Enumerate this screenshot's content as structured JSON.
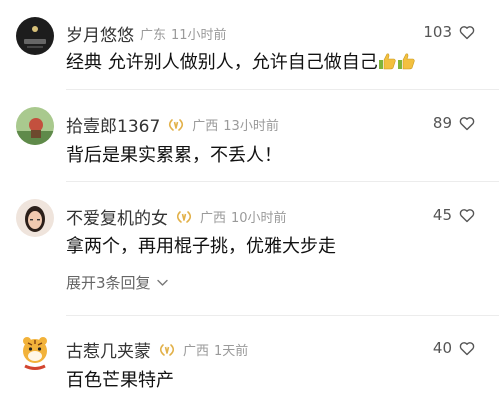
{
  "comments": [
    {
      "username": "岁月悠悠",
      "region": "广东",
      "time": "11小时前",
      "likes": "103",
      "text": "经典   允许别人做别人，允许自己做自己",
      "has_badge": false,
      "emoji": "thumbs-up-icon"
    },
    {
      "username": "拾壹郎1367",
      "region": "广西",
      "time": "13小时前",
      "likes": "89",
      "text": "背后是果实累累，不丢人！",
      "has_badge": true
    },
    {
      "username": "不爱复机的女",
      "region": "广西",
      "time": "10小时前",
      "likes": "45",
      "text": "拿两个，再用棍子挑，优雅大步走",
      "has_badge": true,
      "expand_label": "展开3条回复"
    },
    {
      "username": "古惹几夹蒙",
      "region": "广西",
      "time": "1天前",
      "likes": "40",
      "text": "百色芒果特产",
      "has_badge": true
    }
  ],
  "colors": {
    "badge": "#e2b14a",
    "meta": "#9a9a9a",
    "text": "#111111"
  }
}
